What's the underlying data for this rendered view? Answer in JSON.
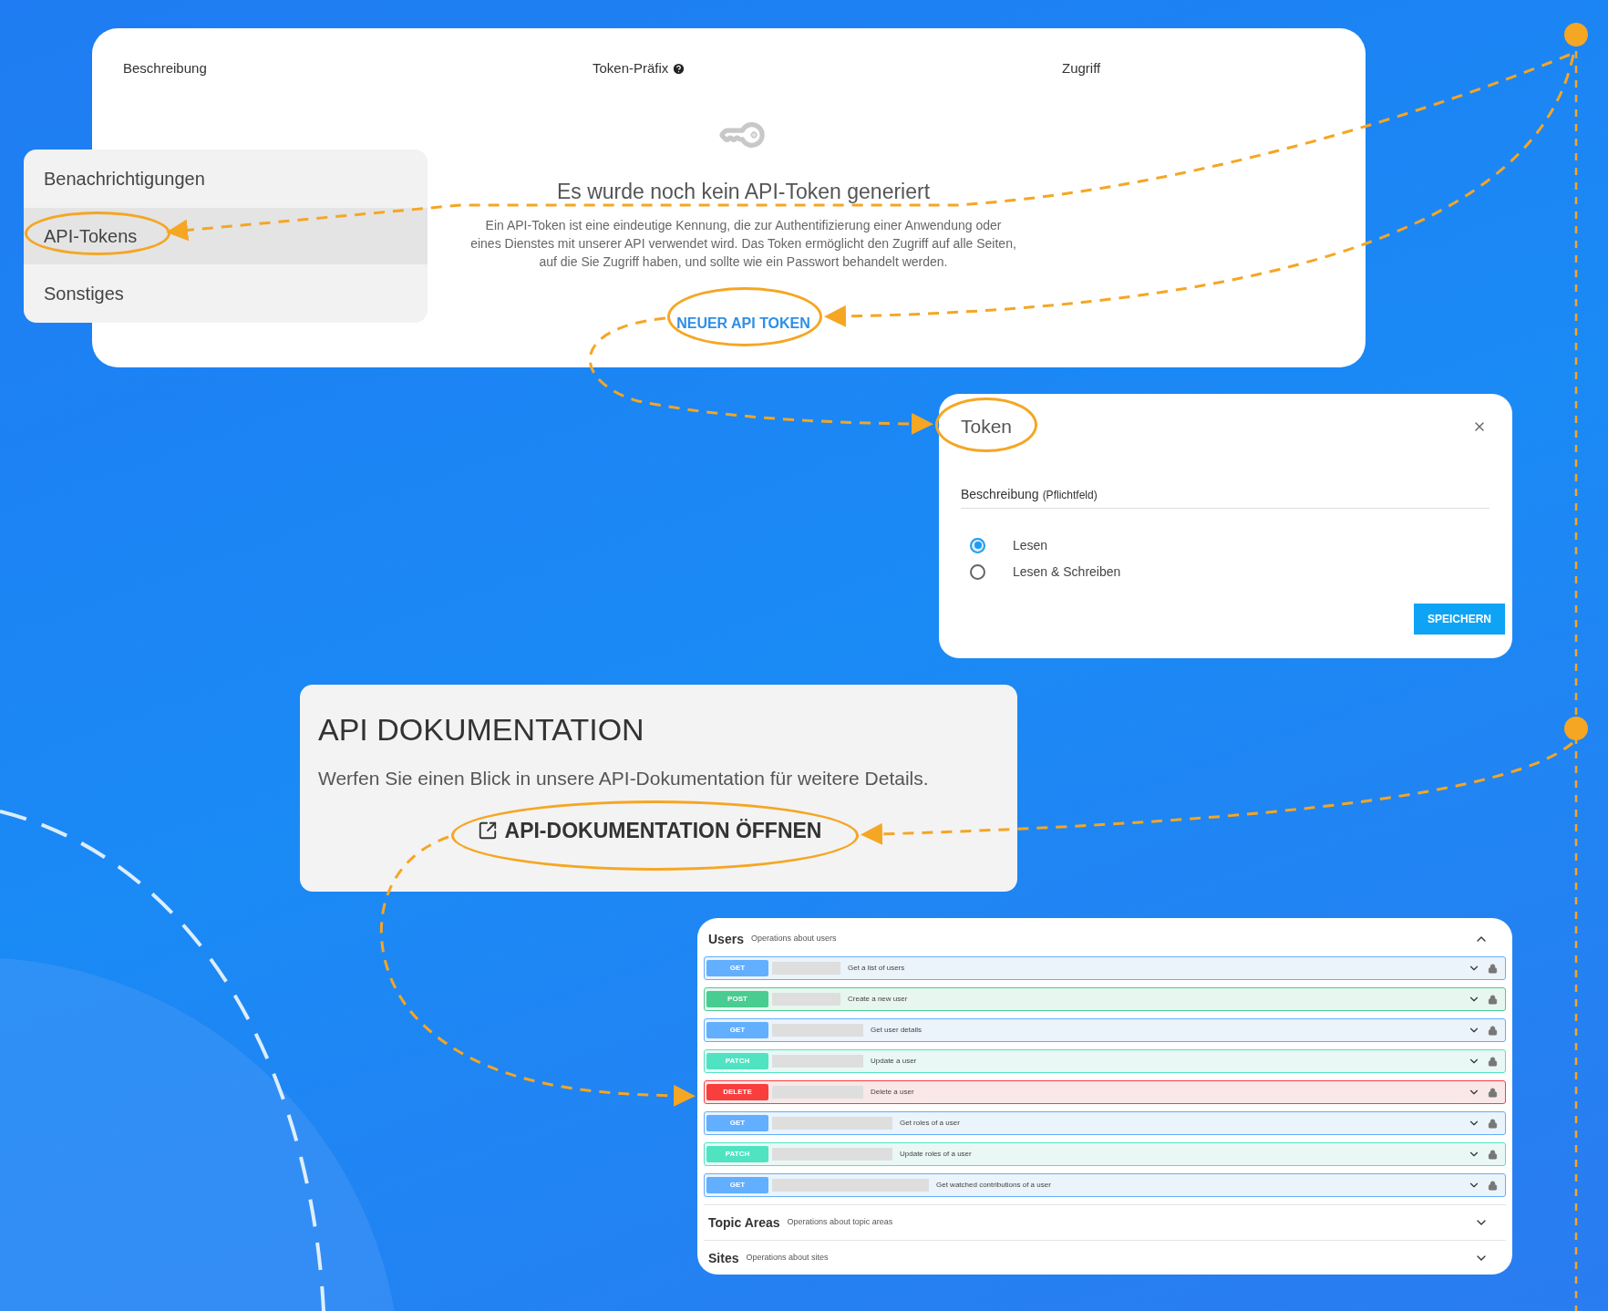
{
  "token_table": {
    "columns": [
      "Beschreibung",
      "Token-Präfix",
      "Zugriff"
    ],
    "empty_state": {
      "title": "Es wurde noch kein API-Token generiert",
      "text": "Ein API-Token ist eine eindeutige Kennung, die zur Authentifizierung einer Anwendung oder eines Dienstes mit unserer API verwendet wird. Das Token ermöglicht den Zugriff auf alle Seiten, auf die Sie Zugriff haben, und sollte wie ein Passwort behandelt werden.",
      "button": "NEUER API TOKEN"
    }
  },
  "sidebar": {
    "items": [
      {
        "label": "Benachrichtigungen",
        "selected": false
      },
      {
        "label": "API-Tokens",
        "selected": true
      },
      {
        "label": "Sonstiges",
        "selected": false
      }
    ]
  },
  "dialog": {
    "title": "Token",
    "field_label": "Beschreibung",
    "field_hint": "(Pflichtfeld)",
    "options": [
      {
        "label": "Lesen",
        "selected": true
      },
      {
        "label": "Lesen & Schreiben",
        "selected": false
      }
    ],
    "button": "SPEICHERN"
  },
  "docs": {
    "title": "API DOKUMENTATION",
    "text": "Werfen Sie einen Blick in unsere API-Dokumentation für weitere Details.",
    "link": "API-DOKUMENTATION ÖFFNEN"
  },
  "api_groups": [
    {
      "name": "Users",
      "description": "Operations about users",
      "expanded": true,
      "operations": [
        {
          "kind": "get",
          "method": "GET",
          "summary": "Get a list of users"
        },
        {
          "kind": "post",
          "method": "POST",
          "summary": "Create a new user"
        },
        {
          "kind": "get",
          "method": "GET",
          "summary": "Get user details"
        },
        {
          "kind": "patch",
          "method": "PATCH",
          "summary": "Update a user"
        },
        {
          "kind": "delete",
          "method": "DELETE",
          "summary": "Delete a user"
        },
        {
          "kind": "get",
          "method": "GET",
          "summary": "Get roles of a user"
        },
        {
          "kind": "patch",
          "method": "PATCH",
          "summary": "Update roles of a user"
        },
        {
          "kind": "get",
          "method": "GET",
          "summary": "Get watched contributions of a user"
        }
      ]
    },
    {
      "name": "Topic Areas",
      "description": "Operations about topic areas",
      "expanded": false
    },
    {
      "name": "Sites",
      "description": "Operations about sites",
      "expanded": false
    }
  ]
}
